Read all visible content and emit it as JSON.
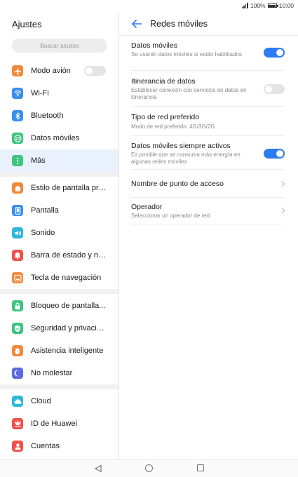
{
  "status": {
    "battery": "100%",
    "time": "10:00"
  },
  "sidebar": {
    "title": "Ajustes",
    "search_placeholder": "Buscar ajustes",
    "items": [
      {
        "label": "Modo avión",
        "icon": "airplane-icon",
        "color": "#f08a3a"
      },
      {
        "label": "Wi-Fi",
        "icon": "wifi-icon",
        "color": "#3a8ef0"
      },
      {
        "label": "Bluetooth",
        "icon": "bluetooth-icon",
        "color": "#3a8ef0"
      },
      {
        "label": "Datos móviles",
        "icon": "mobile-data-icon",
        "color": "#3dc47e"
      },
      {
        "label": "Más",
        "icon": "more-icon",
        "color": "#3dc47e"
      },
      {
        "label": "Estilo de pantalla pri...",
        "icon": "home-icon",
        "color": "#f08a3a"
      },
      {
        "label": "Pantalla",
        "icon": "display-icon",
        "color": "#3a8ef0"
      },
      {
        "label": "Sonido",
        "icon": "sound-icon",
        "color": "#2fb8d8"
      },
      {
        "label": "Barra de estado y no...",
        "icon": "notification-icon",
        "color": "#f0504a"
      },
      {
        "label": "Tecla de navegación",
        "icon": "navigation-key-icon",
        "color": "#f08a3a"
      },
      {
        "label": "Bloqueo de pantalla...",
        "icon": "lock-icon",
        "color": "#3dc47e"
      },
      {
        "label": "Seguridad y privacid...",
        "icon": "shield-icon",
        "color": "#3dc47e"
      },
      {
        "label": "Asistencia inteligente",
        "icon": "hand-icon",
        "color": "#f08a3a"
      },
      {
        "label": "No molestar",
        "icon": "moon-icon",
        "color": "#5b6ae0"
      },
      {
        "label": "Cloud",
        "icon": "cloud-icon",
        "color": "#2fb8d8"
      },
      {
        "label": "ID de Huawei",
        "icon": "huawei-icon",
        "color": "#f0504a"
      },
      {
        "label": "Cuentas",
        "icon": "account-icon",
        "color": "#f0504a"
      }
    ]
  },
  "detail": {
    "title": "Redes móviles",
    "items": [
      {
        "title": "Datos móviles",
        "subtitle": "Se usarán datos móviles si están habilitados",
        "control": "toggle-on"
      },
      {
        "title": "Itinerancia de datos",
        "subtitle": "Establecer conexión con servicios de datos en itinerancia",
        "control": "toggle-off"
      },
      {
        "title": "Tipo de red preferido",
        "subtitle": "Modo de red preferido: 4G/3G/2G",
        "control": "none"
      },
      {
        "title": "Datos móviles siempre activos",
        "subtitle": "Es posible que se consuma más energía en algunas redes móviles",
        "control": "toggle-on"
      },
      {
        "title": "Nombre de punto de acceso",
        "subtitle": "",
        "control": "chevron"
      },
      {
        "title": "Operador",
        "subtitle": "Seleccionar un operador de red",
        "control": "chevron"
      }
    ]
  },
  "colors": {
    "accent": "#2b7cf0",
    "selected_row": "#e8f1fc"
  }
}
